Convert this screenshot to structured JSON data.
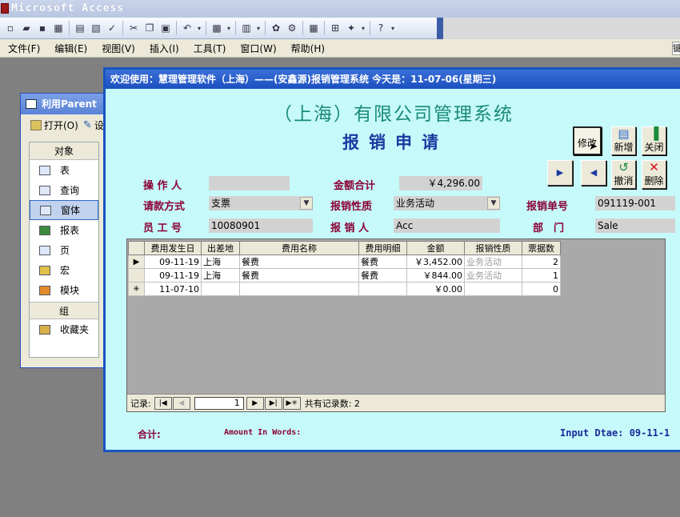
{
  "app": {
    "title": "Microsoft Access",
    "ime_char": "键"
  },
  "menu": [
    "文件(F)",
    "编辑(E)",
    "视图(V)",
    "插入(I)",
    "工具(T)",
    "窗口(W)",
    "帮助(H)"
  ],
  "dbwin": {
    "title": "利用Parent",
    "open": "打开(O)",
    "design_fragment": "设",
    "objects_header": "对象",
    "objects": [
      "表",
      "查询",
      "窗体",
      "报表",
      "页",
      "宏",
      "模块"
    ],
    "group_header": "组",
    "groups": [
      "收藏夹"
    ]
  },
  "form": {
    "title": "欢迎使用：慧理管理软件（上海）——(安鑫源)报销管理系统 今天是：11-07-06(星期三)",
    "company": "（上海）有限公司管理系统",
    "heading": "报销申请",
    "buttons": {
      "edit": "修改",
      "new": "新增",
      "close": "关闭",
      "undo": "撤消",
      "delete": "删除"
    },
    "labels": {
      "operator": "操 作 人",
      "total": "金额合计",
      "payment": "请款方式",
      "nature": "报销性质",
      "doc_no": "报销单号",
      "emp_no": "员 工 号",
      "applicant": "报 销 人",
      "dept": "部　门"
    },
    "values": {
      "operator": "",
      "total": "￥4,296.00",
      "payment": "支票",
      "nature": "业务活动",
      "doc_no": "091119-001",
      "emp_no": "10080901",
      "applicant": "Acc",
      "dept": "Sale"
    },
    "grid": {
      "headers": [
        "费用发生日",
        "出差地",
        "费用名称",
        "费用明细",
        "金额",
        "报销性质",
        "票据数"
      ],
      "rows": [
        {
          "sel": "▶",
          "date": "09-11-19",
          "place": "上海",
          "name": "餐费",
          "detail": "餐费",
          "amount": "￥3,452.00",
          "nature": "业务活动",
          "count": "2"
        },
        {
          "sel": "",
          "date": "09-11-19",
          "place": "上海",
          "name": "餐费",
          "detail": "餐费",
          "amount": "￥844.00",
          "nature": "业务活动",
          "count": "1"
        },
        {
          "sel": "✳",
          "date": "11-07-10",
          "place": "",
          "name": "",
          "detail": "",
          "amount": "￥0.00",
          "nature": "",
          "count": "0"
        }
      ]
    },
    "nav": {
      "label": "记录:",
      "current": "1",
      "total_text": "共有记录数: 2"
    },
    "footer": {
      "sum_label": "合计:",
      "words_label": "Amount In Words:",
      "input_date": "Input Dtae: 09-11-1"
    },
    "colors": {
      "title_bar": "#1c50c0",
      "background": "#c6fafa",
      "label": "#8b0036",
      "company": "#1a8a7a",
      "heading": "#1a3aa0"
    }
  }
}
